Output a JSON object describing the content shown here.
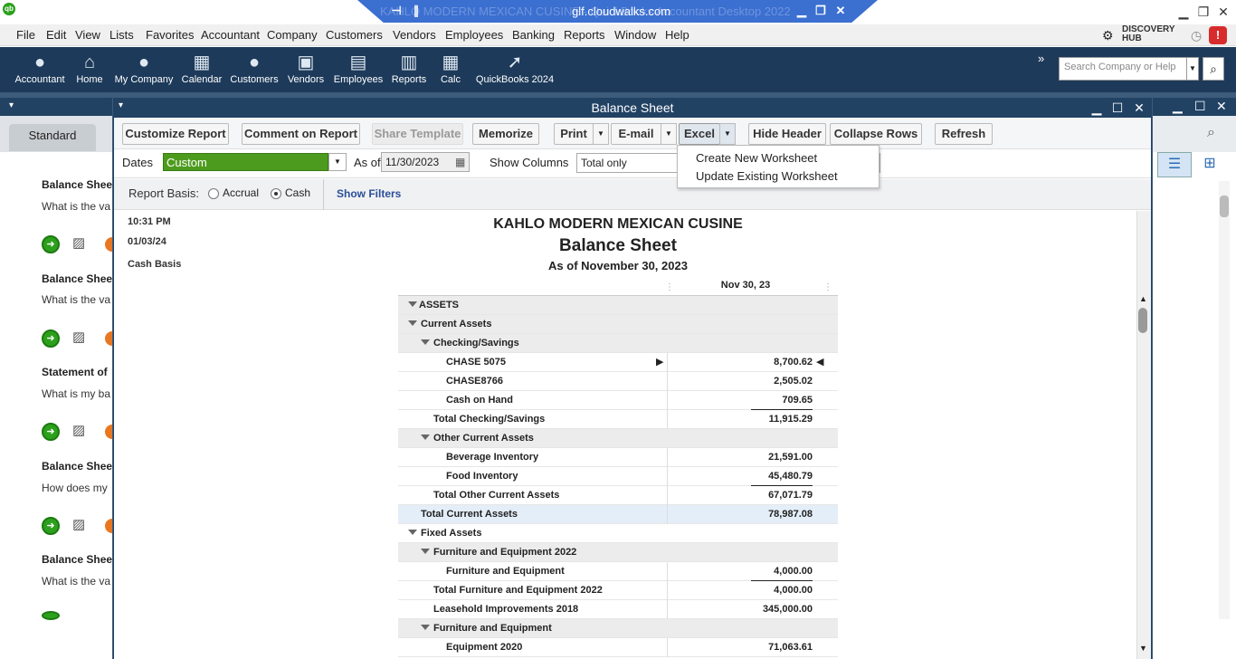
{
  "titlebar": {
    "ghost_title": "KAHLO MODERN MEXICAN CUSINE - QuickBooks Accountant Desktop 2022",
    "host": "glf.cloudwalks.com",
    "minimize": "▁",
    "restore": "❐",
    "close": "✕"
  },
  "menu": [
    "File",
    "Edit",
    "View",
    "Lists",
    "Favorites",
    "Accountant",
    "Company",
    "Customers",
    "Vendors",
    "Employees",
    "Banking",
    "Reports",
    "Window",
    "Help"
  ],
  "discovery_hub": "DISCOVERY HUB",
  "icon_bar": [
    {
      "label": "Accountant",
      "icon": "person-icon"
    },
    {
      "label": "Home",
      "icon": "home-icon"
    },
    {
      "label": "My Company",
      "icon": "company-icon"
    },
    {
      "label": "Calendar",
      "icon": "calendar-icon"
    },
    {
      "label": "Customers",
      "icon": "customers-icon"
    },
    {
      "label": "Vendors",
      "icon": "vendors-icon"
    },
    {
      "label": "Employees",
      "icon": "employees-icon"
    },
    {
      "label": "Reports",
      "icon": "reports-icon"
    },
    {
      "label": "Calc",
      "icon": "calculator-icon"
    },
    {
      "label": "QuickBooks 2024",
      "icon": "upgrade-arrow-icon"
    }
  ],
  "search": {
    "placeholder": "Search Company or Help"
  },
  "left_pane": {
    "tab": "Standard",
    "items": [
      {
        "title": "Balance Shee",
        "question": "What is the va"
      },
      {
        "title": "Balance Shee",
        "question": "What is the va"
      },
      {
        "title": "Statement of",
        "question": "What is my ba"
      },
      {
        "title": "Balance Shee",
        "question": "How does my"
      },
      {
        "title": "Balance Shee",
        "question": "What is the va"
      }
    ]
  },
  "report_window": {
    "title": "Balance Sheet",
    "toolbar": {
      "customize": "Customize Report",
      "comment": "Comment on Report",
      "share": "Share Template",
      "memorize": "Memorize",
      "print": "Print",
      "email": "E-mail",
      "excel": "Excel",
      "hide_header": "Hide Header",
      "collapse": "Collapse Rows",
      "refresh": "Refresh"
    },
    "filters": {
      "dates_label": "Dates",
      "dates_value": "Custom",
      "asof_label": "As of",
      "asof_value": "11/30/2023",
      "showcols_label": "Show Columns",
      "showcols_value": "Total only"
    },
    "basis": {
      "label": "Report Basis:",
      "accrual": "Accrual",
      "cash": "Cash",
      "selected": "Cash",
      "show_filters": "Show Filters"
    },
    "excel_menu": [
      "Create New Worksheet",
      "Update Existing Worksheet"
    ]
  },
  "report": {
    "time": "10:31 PM",
    "date": "01/03/24",
    "basis": "Cash Basis",
    "company": "KAHLO MODERN MEXICAN CUSINE",
    "name": "Balance Sheet",
    "as_of": "As of November 30, 2023",
    "column": "Nov 30, 23",
    "rows": [
      {
        "label": "ASSETS",
        "value": ""
      },
      {
        "label": "Current Assets",
        "value": ""
      },
      {
        "label": "Checking/Savings",
        "value": ""
      },
      {
        "label": "CHASE 5075",
        "value": "8,700.62"
      },
      {
        "label": "CHASE8766",
        "value": "2,505.02"
      },
      {
        "label": "Cash on Hand",
        "value": "709.65"
      },
      {
        "label": "Total Checking/Savings",
        "value": "11,915.29"
      },
      {
        "label": "Other Current Assets",
        "value": ""
      },
      {
        "label": "Beverage Inventory",
        "value": "21,591.00"
      },
      {
        "label": "Food Inventory",
        "value": "45,480.79"
      },
      {
        "label": "Total Other Current Assets",
        "value": "67,071.79"
      },
      {
        "label": "Total Current Assets",
        "value": "78,987.08"
      },
      {
        "label": "Fixed Assets",
        "value": ""
      },
      {
        "label": "Furniture and Equipment 2022",
        "value": ""
      },
      {
        "label": "Furniture and Equipment",
        "value": "4,000.00"
      },
      {
        "label": "Total Furniture and Equipment 2022",
        "value": "4,000.00"
      },
      {
        "label": "Leasehold Improvements 2018",
        "value": "345,000.00"
      },
      {
        "label": "Furniture and Equipment",
        "value": ""
      },
      {
        "label": "Equipment 2020",
        "value": "71,063.61"
      }
    ]
  }
}
